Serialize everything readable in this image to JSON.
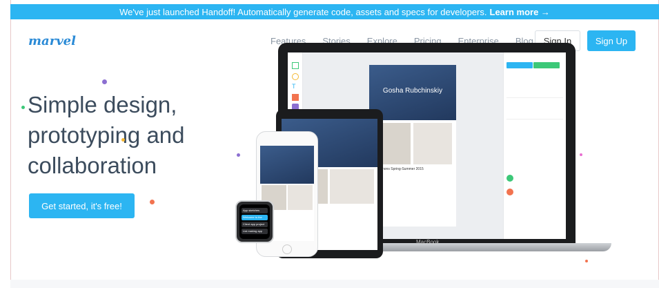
{
  "announcement": {
    "text": "We've just launched Handoff! Automatically generate code, assets and specs for developers.",
    "link_label": "Learn more →"
  },
  "brand": {
    "logo_text": "marvel"
  },
  "nav": {
    "items": [
      {
        "label": "Features"
      },
      {
        "label": "Stories"
      },
      {
        "label": "Explore"
      },
      {
        "label": "Pricing"
      },
      {
        "label": "Enterprise"
      },
      {
        "label": "Blog"
      }
    ],
    "signin_label": "Sign In",
    "signup_label": "Sign Up"
  },
  "hero": {
    "title_lines": [
      "Simple design,",
      "prototyping and",
      "collaboration"
    ],
    "cta_label": "Get started, it's free!"
  },
  "devices": {
    "laptop_brand": "MacBook",
    "artboard_title": "Gosha Rubchinskiy",
    "product_caption": "Raf Simons Spring-Summer 2015",
    "watch_items": [
      "App sketches",
      "Welcome to the",
      "Client app project",
      "List making app"
    ]
  },
  "colors": {
    "accent": "#2cb5f2",
    "text_dark": "#3c4c5d",
    "nav_text": "#8a96a3"
  }
}
